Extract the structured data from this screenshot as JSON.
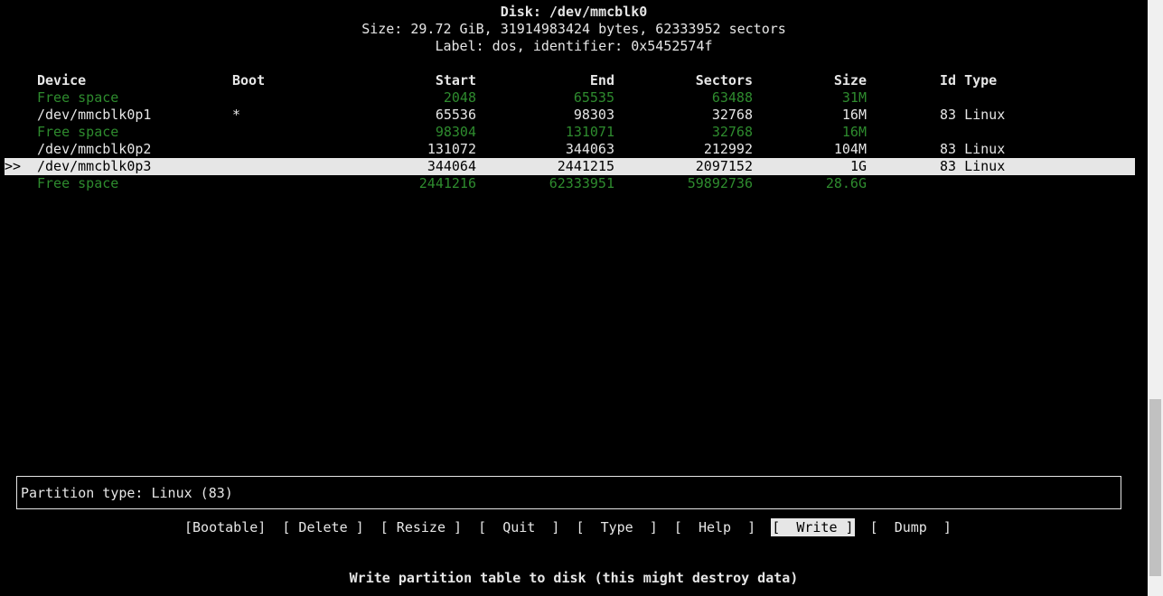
{
  "header": {
    "disk": "Disk: /dev/mmcblk0",
    "size": "Size: 29.72 GiB, 31914983424 bytes, 62333952 sectors",
    "label": "Label: dos, identifier: 0x5452574f"
  },
  "columns": {
    "device": "Device",
    "boot": "Boot",
    "start": "Start",
    "end": "End",
    "sectors": "Sectors",
    "size": "Size",
    "idtype": "Id Type"
  },
  "rows": [
    {
      "marker": "",
      "device": "Free space",
      "boot": "",
      "start": "2048",
      "end": "65535",
      "sectors": "63488",
      "size": "31M",
      "idtype": "",
      "free": true
    },
    {
      "marker": "",
      "device": "/dev/mmcblk0p1",
      "boot": "*",
      "start": "65536",
      "end": "98303",
      "sectors": "32768",
      "size": "16M",
      "idtype": "83 Linux",
      "free": false
    },
    {
      "marker": "",
      "device": "Free space",
      "boot": "",
      "start": "98304",
      "end": "131071",
      "sectors": "32768",
      "size": "16M",
      "idtype": "",
      "free": true
    },
    {
      "marker": "",
      "device": "/dev/mmcblk0p2",
      "boot": "",
      "start": "131072",
      "end": "344063",
      "sectors": "212992",
      "size": "104M",
      "idtype": "83 Linux",
      "free": false
    },
    {
      "marker": ">>",
      "device": "/dev/mmcblk0p3",
      "boot": "",
      "start": "344064",
      "end": "2441215",
      "sectors": "2097152",
      "size": "1G",
      "idtype": "83 Linux",
      "free": false,
      "selected": true
    },
    {
      "marker": "",
      "device": "Free space",
      "boot": "",
      "start": "2441216",
      "end": "62333951",
      "sectors": "59892736",
      "size": "28.6G",
      "idtype": "",
      "free": true
    }
  ],
  "info": {
    "text": "Partition type: Linux (83)"
  },
  "menu": [
    {
      "label": "[Bootable]",
      "active": false
    },
    {
      "label": "[ Delete ]",
      "active": false
    },
    {
      "label": "[ Resize ]",
      "active": false
    },
    {
      "label": "[  Quit  ]",
      "active": false
    },
    {
      "label": "[  Type  ]",
      "active": false
    },
    {
      "label": "[  Help  ]",
      "active": false
    },
    {
      "label": "[  Write ]",
      "active": true
    },
    {
      "label": "[  Dump  ]",
      "active": false
    }
  ],
  "hint": {
    "text": "Write partition table to disk (this might destroy data)"
  },
  "colors": {
    "free_space": "#2e8b2e",
    "foreground": "#e6e6e6",
    "background": "#000000"
  }
}
